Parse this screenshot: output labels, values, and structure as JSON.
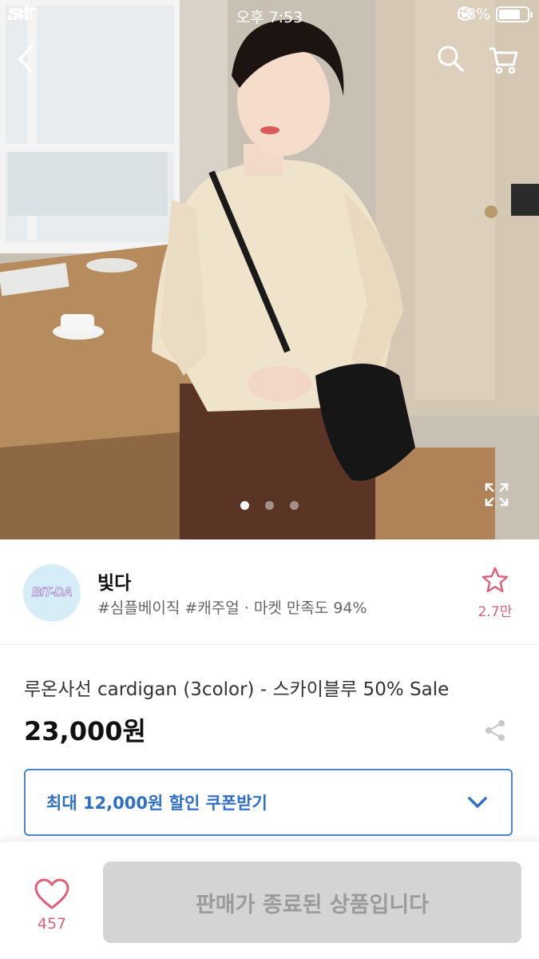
{
  "status_bar": {
    "carrier": "SKT",
    "time": "오후 7:53",
    "battery": "68%"
  },
  "gallery": {
    "image_count": 3,
    "active_index": 0
  },
  "shop": {
    "logo_text": "BIT-DA",
    "name": "빛다",
    "tags": "#심플베이직 #캐주얼 · 마켓 만족도 94%",
    "favorite_count": "2.7만"
  },
  "product": {
    "title": "루온사선 cardigan (3color) - 스카이블루 50%  Sale",
    "price": "23,000원"
  },
  "coupon": {
    "label": "최대 12,000원 할인 쿠폰받기"
  },
  "bottom_bar": {
    "like_count": "457",
    "buy_label": "판매가 종료된 상품입니다"
  },
  "colors": {
    "accent_blue": "#2f6fc4",
    "accent_pink": "#e0607a",
    "disabled_gray": "#d4d4d4"
  }
}
